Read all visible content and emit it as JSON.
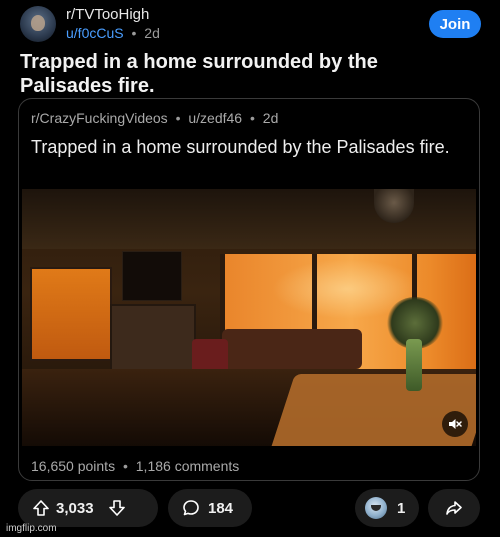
{
  "post": {
    "subreddit": "r/TVTooHigh",
    "username": "u/f0cCuS",
    "separator": "•",
    "age": "2d",
    "join_label": "Join",
    "title": "Trapped in a home surrounded by the Palisades fire."
  },
  "crosspost": {
    "subreddit": "r/CrazyFuckingVideos",
    "username": "u/zedf46",
    "age": "2d",
    "title": "Trapped in a home surrounded by the Palisades fire.",
    "points": "16,650 points",
    "comments": "1,186 comments",
    "media_icon": "mute-icon"
  },
  "actions": {
    "upvotes": "3,033",
    "comments": "184",
    "awards": "1",
    "icons": [
      "upvote-icon",
      "downvote-icon",
      "comment-icon",
      "award-icon",
      "share-icon"
    ]
  },
  "watermark": "imgflip.com",
  "colors": {
    "accent": "#1f7ff2",
    "username": "#4a9eff",
    "background": "#000000"
  }
}
